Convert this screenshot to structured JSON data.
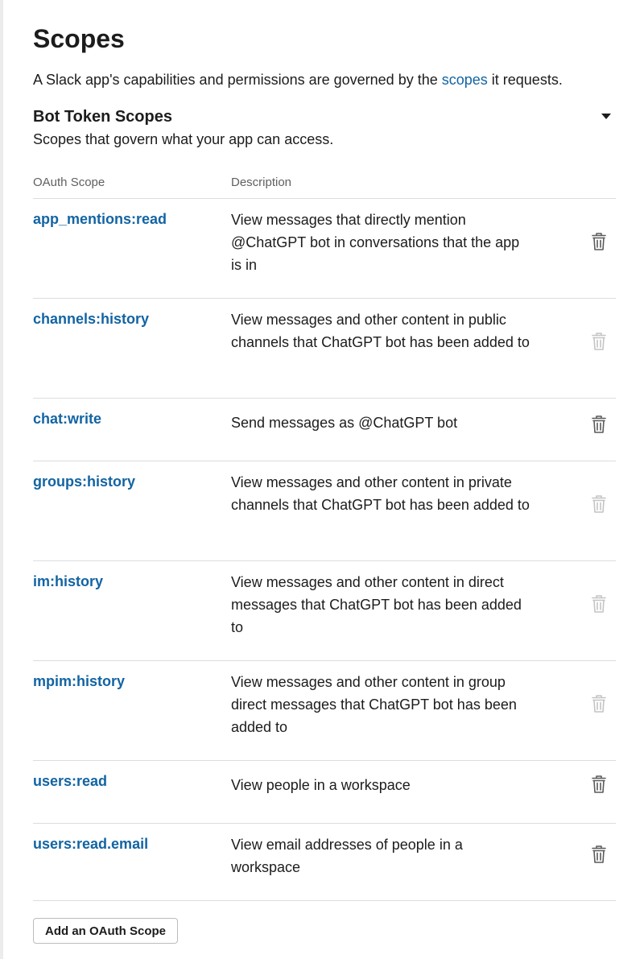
{
  "page": {
    "title": "Scopes",
    "intro_before": "A Slack app's capabilities and permissions are governed by the ",
    "intro_link": "scopes",
    "intro_after": " it requests."
  },
  "section": {
    "title": "Bot Token Scopes",
    "subtitle": "Scopes that govern what your app can access.",
    "toggle_icon": "caret-down-icon"
  },
  "table": {
    "headers": {
      "scope": "OAuth Scope",
      "description": "Description"
    },
    "rows": [
      {
        "scope": "app_mentions:read",
        "description": "View messages that directly mention @ChatGPT bot in conversations that the app is in",
        "removable": true
      },
      {
        "scope": "channels:history",
        "description": "View messages and other content in public channels that ChatGPT bot has been added to",
        "removable": false
      },
      {
        "scope": "chat:write",
        "description": "Send messages as @ChatGPT bot",
        "removable": true
      },
      {
        "scope": "groups:history",
        "description": "View messages and other content in private channels that ChatGPT bot has been added to",
        "removable": false
      },
      {
        "scope": "im:history",
        "description": "View messages and other content in direct messages that ChatGPT bot has been added to",
        "removable": false
      },
      {
        "scope": "mpim:history",
        "description": "View messages and other content in group direct messages that ChatGPT bot has been added to",
        "removable": false
      },
      {
        "scope": "users:read",
        "description": "View people in a workspace",
        "removable": true
      },
      {
        "scope": "users:read.email",
        "description": "View email addresses of people in a workspace",
        "removable": true
      }
    ]
  },
  "actions": {
    "add_scope_label": "Add an OAuth Scope"
  },
  "colors": {
    "link": "#1264a3",
    "text": "#1d1c1d",
    "muted": "#616061",
    "border": "#dddddd",
    "trash_enabled": "#5a5a5a",
    "trash_disabled": "#c4c4c4"
  },
  "icons": {
    "delete": "trash-icon",
    "toggle": "caret-down-icon"
  }
}
